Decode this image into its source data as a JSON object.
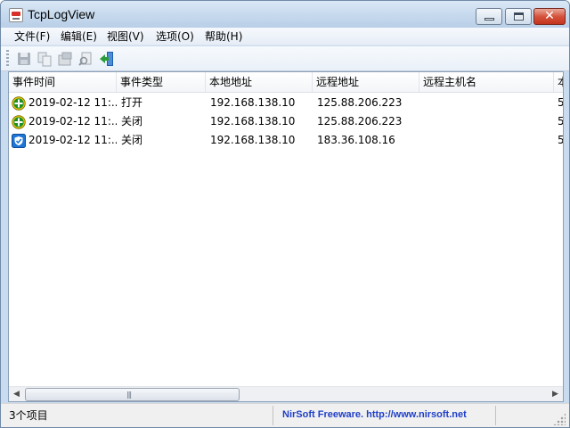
{
  "window": {
    "title": "TcpLogView"
  },
  "menu": [
    {
      "label": "文件(F)"
    },
    {
      "label": "编辑(E)"
    },
    {
      "label": "视图(V)"
    },
    {
      "label": "选项(O)"
    },
    {
      "label": "帮助(H)"
    }
  ],
  "toolbar": {
    "icons": [
      "save-icon",
      "copy-icon",
      "properties-icon",
      "find-icon",
      "exit-icon"
    ]
  },
  "table": {
    "columns": [
      {
        "label": "事件时间"
      },
      {
        "label": "事件类型"
      },
      {
        "label": "本地地址"
      },
      {
        "label": "远程地址"
      },
      {
        "label": "远程主机名"
      },
      {
        "label": "本"
      }
    ],
    "rows": [
      {
        "icon": "green-plus-icon",
        "time": "2019-02-12 11:...",
        "type": "打开",
        "local": "192.168.138.10",
        "remote": "125.88.206.223",
        "host": "",
        "extra": "5"
      },
      {
        "icon": "green-plus-icon",
        "time": "2019-02-12 11:...",
        "type": "关闭",
        "local": "192.168.138.10",
        "remote": "125.88.206.223",
        "host": "",
        "extra": "5"
      },
      {
        "icon": "blue-shield-icon",
        "time": "2019-02-12 11:...",
        "type": "关闭",
        "local": "192.168.138.10",
        "remote": "183.36.108.16",
        "host": "",
        "extra": "5"
      }
    ]
  },
  "status": {
    "count": "3个项目",
    "link": "NirSoft Freeware.  http://www.nirsoft.net"
  },
  "colors": {
    "link": "#1f3fc8",
    "titlebar": "#c7daee",
    "close": "#c4321c"
  }
}
